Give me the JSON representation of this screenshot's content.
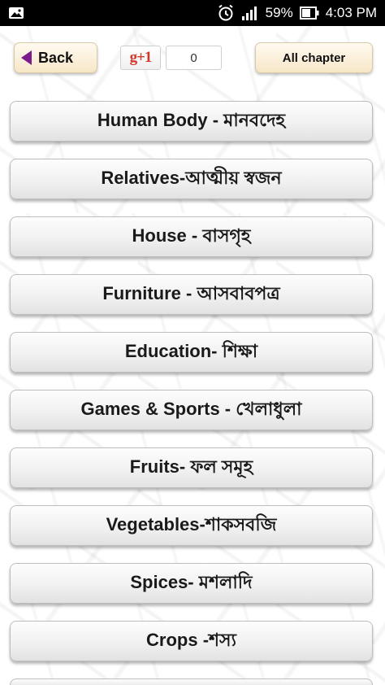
{
  "status_bar": {
    "battery_percent": "59%",
    "time": "4:03 PM",
    "icons": [
      "image-notification-icon",
      "alarm-icon",
      "signal-icon",
      "battery-icon"
    ]
  },
  "toolbar": {
    "back_label": "Back",
    "gplus_label": "g+1",
    "gplus_count": "0",
    "all_chapter_label": "All chapter"
  },
  "colors": {
    "status_bar_bg": "#000000",
    "back_arrow": "#7b1c8a",
    "gplus_red": "#d2372b",
    "toolbar_button_bg": "#f7e7c8",
    "list_button_bg": "#f1f1f1"
  },
  "chapters": [
    {
      "label": "Human Body - মানবদেহ"
    },
    {
      "label": "Relatives-আত্মীয় স্বজন"
    },
    {
      "label": "House - বাসগৃহ"
    },
    {
      "label": "Furniture - আসবাবপত্র"
    },
    {
      "label": "Education- শিক্ষা"
    },
    {
      "label": "Games & Sports - খেলাধুলা"
    },
    {
      "label": "Fruits- ফল সমূহ"
    },
    {
      "label": "Vegetables-শাকসবজি"
    },
    {
      "label": "Spices- মশলাদি"
    },
    {
      "label": "Crops -শস্য"
    }
  ]
}
